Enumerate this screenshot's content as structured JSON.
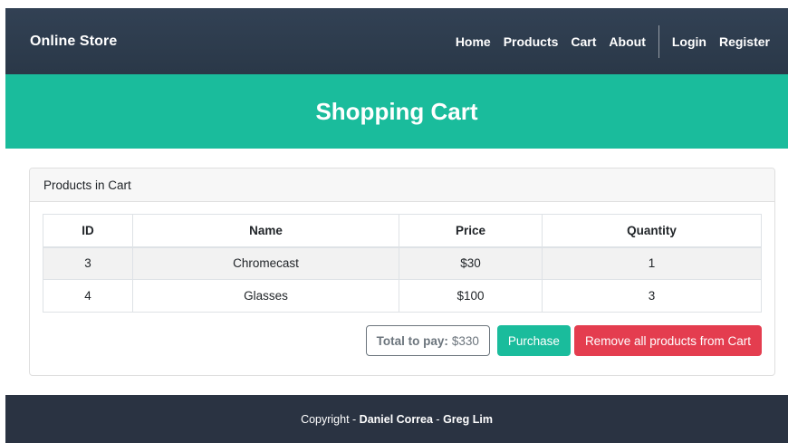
{
  "navbar": {
    "brand": "Online Store",
    "links": [
      "Home",
      "Products",
      "Cart",
      "About"
    ],
    "auth_links": [
      "Login",
      "Register"
    ]
  },
  "hero": {
    "title": "Shopping Cart"
  },
  "card": {
    "header": "Products in Cart",
    "table": {
      "columns": [
        "ID",
        "Name",
        "Price",
        "Quantity"
      ],
      "rows": [
        [
          "3",
          "Chromecast",
          "$30",
          "1"
        ],
        [
          "4",
          "Glasses",
          "$100",
          "3"
        ]
      ]
    },
    "total_label": "Total to pay:",
    "total_value": "$330",
    "purchase_label": "Purchase",
    "remove_label": "Remove all products from Cart"
  },
  "footer": {
    "prefix": "Copyright - ",
    "author1": "Daniel Correa",
    "sep": " - ",
    "author2": "Greg Lim"
  }
}
